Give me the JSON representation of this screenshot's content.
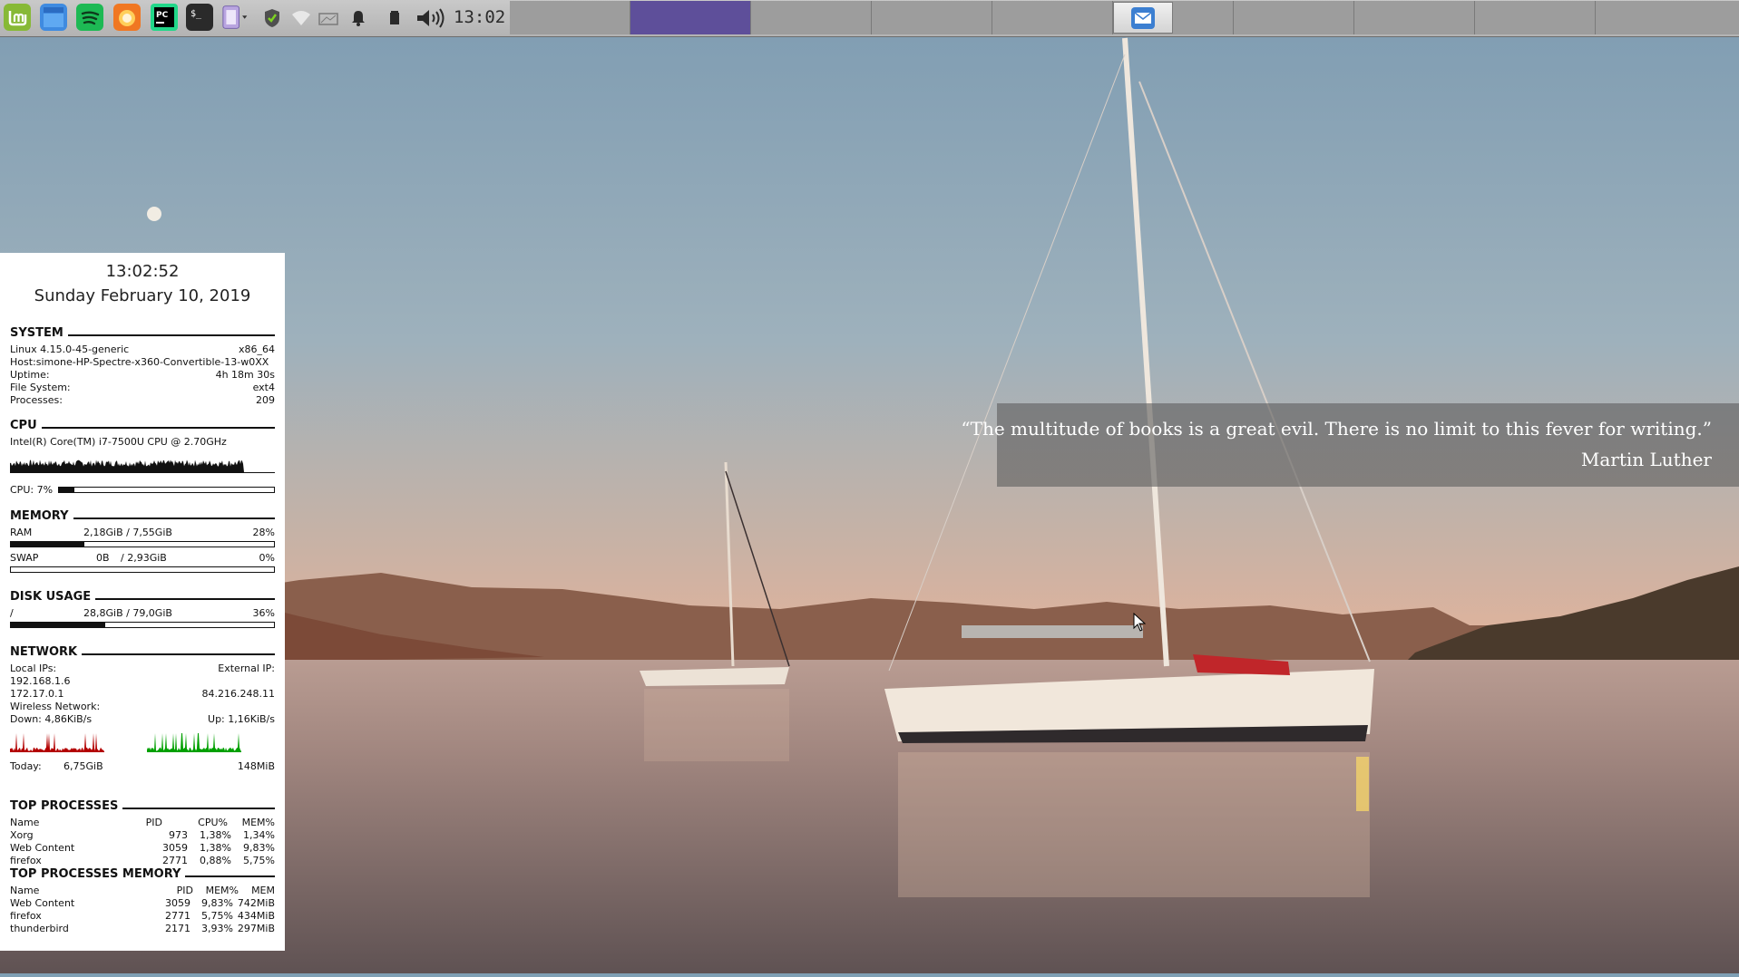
{
  "panel": {
    "launchers": [
      {
        "name": "mint-menu-icon",
        "color": "#87b936"
      },
      {
        "name": "file-manager-icon",
        "color": "#3f8be0"
      },
      {
        "name": "spotify-icon",
        "color": "#1db954"
      },
      {
        "name": "firefox-icon",
        "color": "#f07722"
      },
      {
        "name": "pycharm-icon",
        "color": "#21d789"
      },
      {
        "name": "terminal-icon",
        "color": "#2a2a2a"
      },
      {
        "name": "notes-icon",
        "color": "#b9a5e0"
      }
    ],
    "tray": [
      "shield-check-icon",
      "wifi-icon",
      "network-icon",
      "bell-icon",
      "battery-icon",
      "volume-icon"
    ],
    "clock": "13:02",
    "workspace_active_color": "#5e4f9a",
    "workspaces": 10,
    "active_workspace": 2,
    "taskbar": [
      {
        "name": "thunderbird-window-icon"
      }
    ]
  },
  "conky": {
    "time": "13:02:52",
    "date": "Sunday February 10, 2019",
    "system": {
      "title": "SYSTEM",
      "kernel": "Linux 4.15.0-45-generic",
      "arch": "x86_64",
      "host": "Host:simone-HP-Spectre-x360-Convertible-13-w0XX",
      "uptime_label": "Uptime:",
      "uptime": "4h 18m 30s",
      "fs_label": "File System:",
      "fs": "ext4",
      "proc_label": "Processes:",
      "processes": "209"
    },
    "cpu": {
      "title": "CPU",
      "model": "Intel(R) Core(TM) i7-7500U CPU @ 2.70GHz",
      "usage_label": "CPU: 7%",
      "usage_fraction": 0.07
    },
    "memory": {
      "title": "MEMORY",
      "ram_label": "RAM",
      "ram_value": "2,18GiB / 7,55GiB",
      "ram_percent": "28%",
      "ram_fraction": 0.28,
      "swap_label": "SWAP",
      "swap_used": "0B",
      "swap_total": "/ 2,93GiB",
      "swap_percent": "0%",
      "swap_fraction": 0
    },
    "disk": {
      "title": "DISK USAGE",
      "mount": "/",
      "value": "28,8GiB / 79,0GiB",
      "percent": "36%",
      "fraction": 0.36
    },
    "network": {
      "title": "NETWORK",
      "local_label": "Local IPs:",
      "external_label": "External IP:",
      "local_ip_1": "192.168.1.6",
      "local_ip_2": "172.17.0.1",
      "external_ip": "84.216.248.11",
      "wireless_label": "Wireless Network:",
      "down": "Down: 4,86KiB/s",
      "up": "Up: 1,16KiB/s",
      "down_color": "#b30000",
      "up_color": "#00a000",
      "today_label": "Today:",
      "today_down": "6,75GiB",
      "today_up": "148MiB"
    },
    "top_processes": {
      "title": "TOP PROCESSES",
      "headers": [
        "Name",
        "PID",
        "CPU%",
        "MEM%"
      ],
      "rows": [
        {
          "name": "Xorg",
          "pid": "973",
          "cpu": "1,38%",
          "mem": "1,34%"
        },
        {
          "name": "Web Content",
          "pid": "3059",
          "cpu": "1,38%",
          "mem": "9,83%"
        },
        {
          "name": "firefox",
          "pid": "2771",
          "cpu": "0,88%",
          "mem": "5,75%"
        }
      ]
    },
    "top_memory": {
      "title": "TOP PROCESSES MEMORY",
      "headers": [
        "Name",
        "PID",
        "MEM%",
        "MEM"
      ],
      "rows": [
        {
          "name": "Web Content",
          "pid": "3059",
          "memp": "9,83%",
          "mem": "742MiB"
        },
        {
          "name": "firefox",
          "pid": "2771",
          "memp": "5,75%",
          "mem": "434MiB"
        },
        {
          "name": "thunderbird",
          "pid": "2171",
          "memp": "3,93%",
          "mem": "297MiB"
        }
      ]
    }
  },
  "quote": {
    "text": "“The multitude of books is a great evil. There is no limit to this fever for writing.”",
    "author": "Martin Luther"
  }
}
